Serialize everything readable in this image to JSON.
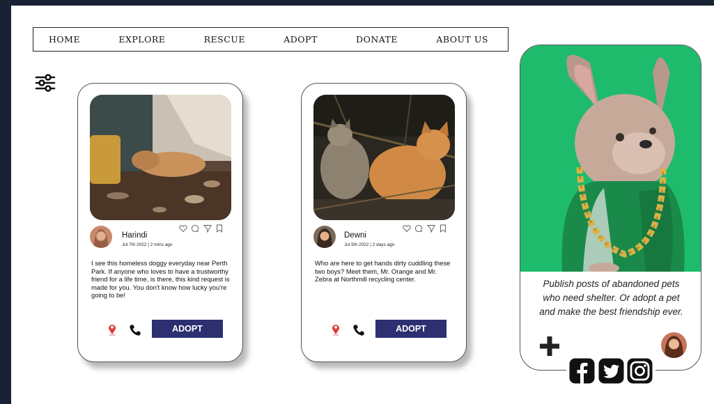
{
  "nav": {
    "items": [
      "HOME",
      "EXPLORE",
      "RESCUE",
      "ADOPT",
      "DONATE",
      "ABOUT US"
    ]
  },
  "posts": [
    {
      "user": "Harindi",
      "meta": "Jul 7th 2022 | 2 mins  ago",
      "text": "I see this homeless doggy everyday near Perth Park. If anyone who loves to have a trustworthy friend for a life time, is there, this kind request is made for you. You don't know how lucky you're going to be!",
      "button": "ADOPT"
    },
    {
      "user": "Dewni",
      "meta": "Jul 5th 2022 | 2 days ago",
      "text": "Who are here to get hands dirty cuddling these two boys? Meet them, Mr. Orange and Mr. Zebra at Northmill recycling center.",
      "button": "ADOPT"
    }
  ],
  "promo": {
    "text": "Publish posts of abandoned pets who need shelter. Or adopt a pet and make the best friendship ever."
  },
  "icons": {
    "filter": "sliders-icon",
    "actions": [
      "heart-icon",
      "comment-icon",
      "share-icon",
      "bookmark-icon"
    ],
    "location": "location-pin-icon",
    "phone": "phone-icon",
    "plus": "plus-icon",
    "social": [
      "facebook-icon",
      "twitter-icon",
      "instagram-icon"
    ]
  },
  "colors": {
    "page_bg": "#172233",
    "button": "#2c2f70",
    "promo_green": "#1fbb6c",
    "pin_red": "#e03a3a"
  }
}
